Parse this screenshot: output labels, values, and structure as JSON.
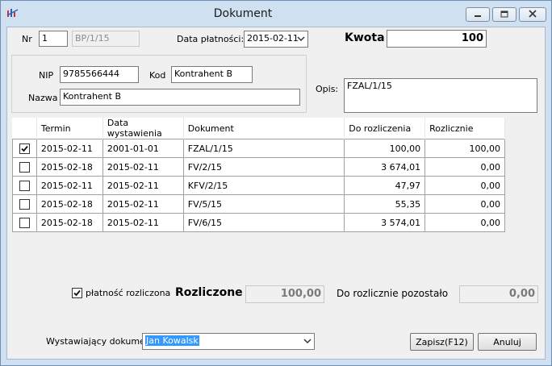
{
  "window": {
    "title": "Dokument"
  },
  "header": {
    "nr_label": "Nr",
    "nr_value": "1",
    "doc_number": "BP/1/15",
    "data_platnosci_label": "Data płatności:",
    "data_platnosci_value": "2015-02-11",
    "kwota_label": "Kwota",
    "kwota_value": "100"
  },
  "contractor": {
    "nip_label": "NIP",
    "nip_value": "9785566444",
    "kod_label": "Kod",
    "kod_value": "Kontrahent B",
    "nazwa_label": "Nazwa",
    "nazwa_value": "Kontrahent B"
  },
  "opis": {
    "label": "Opis:",
    "value": "FZAL/1/15"
  },
  "grid": {
    "columns": [
      "Termin",
      "Data wystawienia",
      "Dokument",
      "Do rozliczenia",
      "Rozlicznie"
    ],
    "rows": [
      {
        "checked": true,
        "termin": "2015-02-11",
        "data_wystawienia": "2001-01-01",
        "dokument": "FZAL/1/15",
        "do_rozliczenia": "100,00",
        "rozlicznie": "100,00"
      },
      {
        "checked": false,
        "termin": "2015-02-18",
        "data_wystawienia": "2015-02-11",
        "dokument": "FV/2/15",
        "do_rozliczenia": "3 674,01",
        "rozlicznie": "0,00"
      },
      {
        "checked": false,
        "termin": "2015-02-11",
        "data_wystawienia": "2015-02-11",
        "dokument": "KFV/2/15",
        "do_rozliczenia": "47,97",
        "rozlicznie": "0,00"
      },
      {
        "checked": false,
        "termin": "2015-02-18",
        "data_wystawienia": "2015-02-11",
        "dokument": "FV/5/15",
        "do_rozliczenia": "55,35",
        "rozlicznie": "0,00"
      },
      {
        "checked": false,
        "termin": "2015-02-18",
        "data_wystawienia": "2015-02-11",
        "dokument": "FV/6/15",
        "do_rozliczenia": "3 574,01",
        "rozlicznie": "0,00"
      }
    ]
  },
  "summary": {
    "platnosc_label": "płatność rozliczona",
    "platnosc_checked": true,
    "rozliczone_label": "Rozliczone",
    "rozliczone_value": "100,00",
    "pozostalo_label": "Do rozlicznie pozostało",
    "pozostalo_value": "0,00"
  },
  "footer": {
    "wystawiajacy_label": "Wystawiający dokument",
    "wystawiajacy_value": "Jan Kowalsk",
    "save_label": "Zapisz(F12)",
    "cancel_label": "Anuluj"
  },
  "colors": {
    "titlebar": "#cfe0f1",
    "selection": "#3399ff",
    "client": "#f0f0f0"
  }
}
